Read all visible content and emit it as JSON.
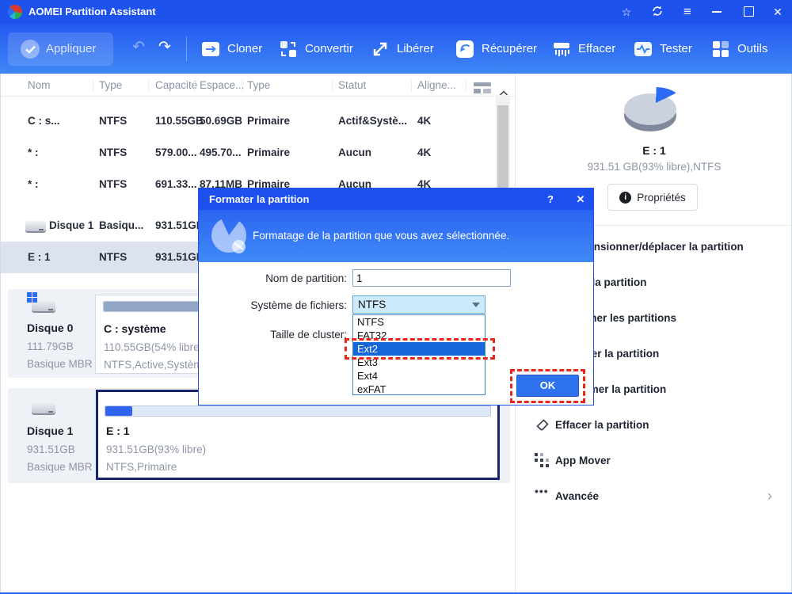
{
  "titlebar": {
    "title": "AOMEI Partition Assistant",
    "icons": {
      "star": "☆",
      "menu": "≡",
      "close": "✕"
    }
  },
  "toolbar": {
    "apply_label": "Appliquer",
    "undo_glyph": "↶",
    "redo_glyph": "↷",
    "buttons": [
      {
        "label": "Cloner"
      },
      {
        "label": "Convertir"
      },
      {
        "label": "Libérer"
      },
      {
        "label": "Récupérer"
      },
      {
        "label": "Effacer"
      },
      {
        "label": "Tester"
      },
      {
        "label": "Outils"
      }
    ]
  },
  "table": {
    "columns": [
      "Nom",
      "Type",
      "Capacité",
      "Espace...",
      "Type",
      "Statut",
      "Aligne..."
    ],
    "scroll_up_glyph": "^",
    "rows": [
      {
        "kind": "partition",
        "selected": false,
        "cells": [
          "C : s...",
          "NTFS",
          "110.55GB",
          "50.69GB",
          "Primaire",
          "Actif&Systè...",
          "4K"
        ]
      },
      {
        "kind": "partition",
        "selected": false,
        "cells": [
          "* :",
          "NTFS",
          "579.00...",
          "495.70...",
          "Primaire",
          "Aucun",
          "4K"
        ]
      },
      {
        "kind": "partition",
        "selected": false,
        "cells": [
          "* :",
          "NTFS",
          "691.33...",
          "87.11MB",
          "Primaire",
          "Aucun",
          "4K"
        ]
      },
      {
        "kind": "disk",
        "selected": false,
        "cells": [
          "Disque 1",
          "Basiqu...",
          "931.51GB",
          "",
          "",
          "",
          ""
        ]
      },
      {
        "kind": "partition",
        "selected": true,
        "cells": [
          "E : 1",
          "NTFS",
          "931.51GB",
          "",
          "",
          "",
          ""
        ]
      }
    ]
  },
  "disks": [
    {
      "name": "Disque 0",
      "size": "111.79GB",
      "style": "Basique MBR",
      "partition": {
        "label": "C : système",
        "capacity": "110.55GB(54% libre)",
        "attrs": "NTFS,Active,Système",
        "used_pct": 46,
        "fill_color": "#93a7c7"
      }
    },
    {
      "name": "Disque 1",
      "size": "931.51GB",
      "style": "Basique MBR",
      "partition": {
        "label": "E : 1",
        "capacity": "931.51GB(93% libre)",
        "attrs": "NTFS,Primaire",
        "used_pct": 7,
        "fill_color": "#3064ee"
      }
    }
  ],
  "sidebar": {
    "partition_name": "E : 1",
    "partition_info": "931.51 GB(93% libre),NTFS",
    "properties_label": "Propriétés",
    "info_glyph": "i",
    "chevron_glyph": "›",
    "ellipsis_glyph": "•••",
    "items": [
      {
        "label": "Redimensionner/déplacer la partition"
      },
      {
        "label": "Cloner la partition"
      },
      {
        "label": "Fusionner les partitions"
      },
      {
        "label": "Formater la partition"
      },
      {
        "label": "Supprimer la partition"
      },
      {
        "label": "Effacer la partition"
      },
      {
        "label": "App Mover"
      },
      {
        "label": "Avancée"
      }
    ]
  },
  "dialog": {
    "title": "Formater la partition",
    "help_glyph": "?",
    "close_glyph": "✕",
    "subtitle": "Formatage de la partition que vous avez sélectionnée.",
    "name_label": "Nom de partition:",
    "name_value": "1",
    "fs_label": "Système de fichiers:",
    "fs_value": "NTFS",
    "cluster_label": "Taille de cluster:",
    "options": [
      "NTFS",
      "FAT32",
      "Ext2",
      "Ext3",
      "Ext4",
      "exFAT"
    ],
    "selected_option": "Ext2",
    "ok_label": "OK"
  },
  "annotations": {
    "dash_color": "#e8251b",
    "targets": [
      "Ext2 option",
      "OK button"
    ]
  }
}
